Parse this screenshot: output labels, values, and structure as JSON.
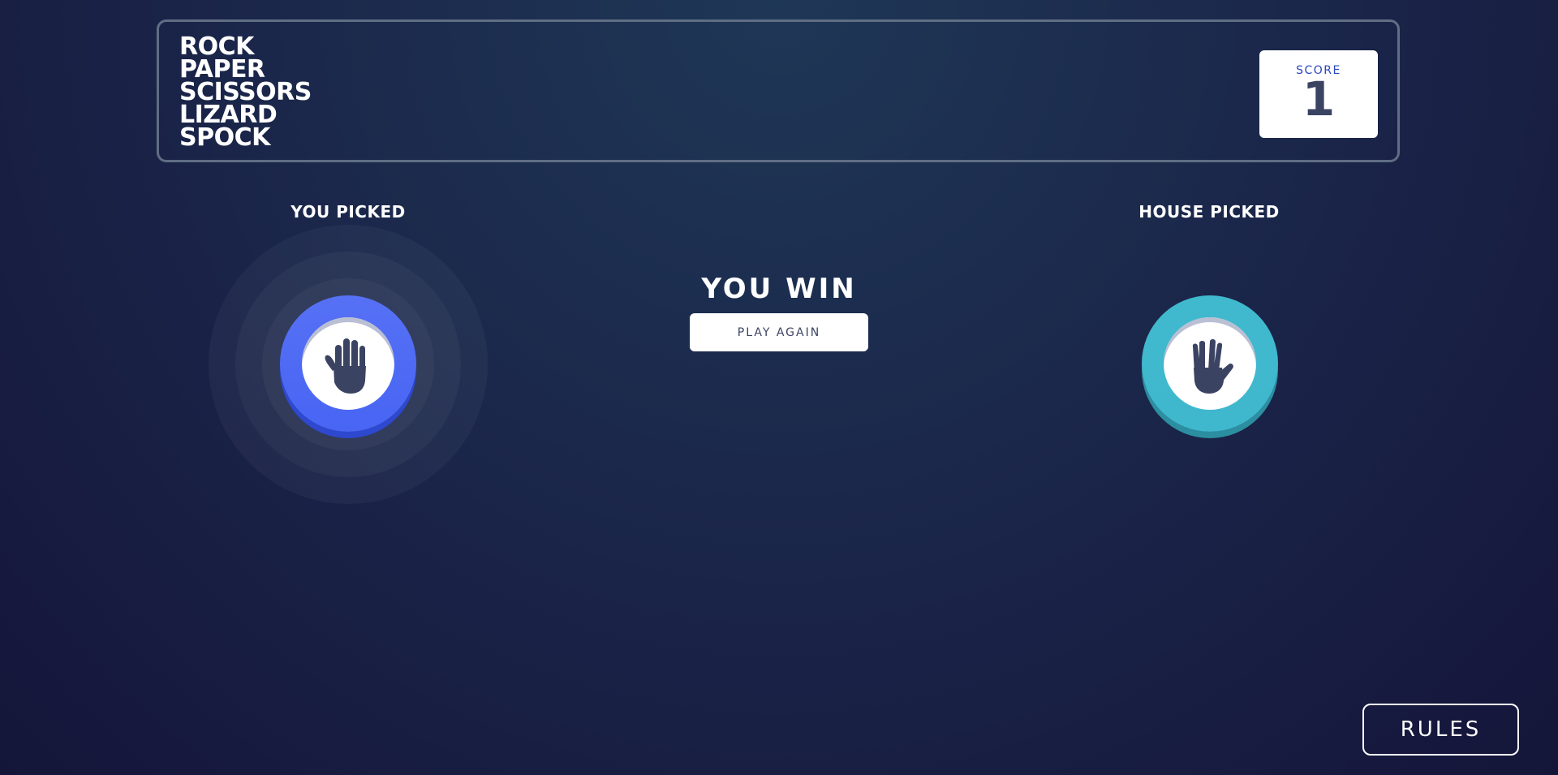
{
  "header": {
    "title_lines": [
      "ROCK",
      "PAPER",
      "SCISSORS",
      "LIZARD",
      "SPOCK"
    ],
    "score_label": "SCORE",
    "score_value": "1"
  },
  "game": {
    "you_picked_label": "YOU PICKED",
    "house_picked_label": "HOUSE PICKED",
    "you_choice": {
      "name": "paper",
      "icon": "paper-hand-icon",
      "color": "#4865f4"
    },
    "house_choice": {
      "name": "spock",
      "icon": "spock-hand-icon",
      "color": "#40b9ce"
    },
    "result_text": "YOU WIN",
    "play_again_label": "PLAY AGAIN",
    "winner": "you"
  },
  "footer": {
    "rules_label": "RULES"
  }
}
